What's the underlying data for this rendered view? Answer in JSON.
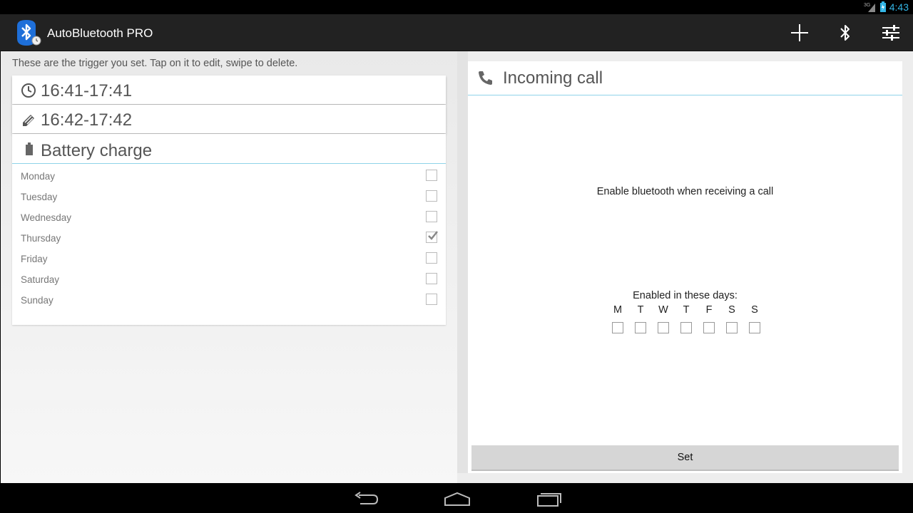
{
  "status_bar": {
    "network": "3G",
    "time": "4:43"
  },
  "action_bar": {
    "title": "AutoBluetooth PRO",
    "icons": [
      "add-icon",
      "bluetooth-icon",
      "settings-sliders-icon"
    ]
  },
  "left": {
    "hint": "These are the trigger you set. Tap on it to edit, swipe to delete.",
    "triggers": [
      {
        "icon": "clock-icon",
        "label": "16:41-17:41"
      },
      {
        "icon": "pencil-icon",
        "label": "16:42-17:42"
      }
    ],
    "battery": {
      "title": "Battery charge",
      "icon": "battery-icon",
      "days": [
        {
          "label": "Monday",
          "checked": false
        },
        {
          "label": "Tuesday",
          "checked": false
        },
        {
          "label": "Wednesday",
          "checked": false
        },
        {
          "label": "Thursday",
          "checked": true
        },
        {
          "label": "Friday",
          "checked": false
        },
        {
          "label": "Saturday",
          "checked": false
        },
        {
          "label": "Sunday",
          "checked": false
        }
      ]
    }
  },
  "right": {
    "title": "Incoming call",
    "icon": "phone-icon",
    "description": "Enable bluetooth when receiving a call",
    "days_label": "Enabled in these days:",
    "weekdays": [
      "M",
      "T",
      "W",
      "T",
      "F",
      "S",
      "S"
    ],
    "set_label": "Set"
  },
  "colors": {
    "accent": "#33b5e5",
    "divider": "#8fd3e9",
    "action_bar": "#222222"
  }
}
